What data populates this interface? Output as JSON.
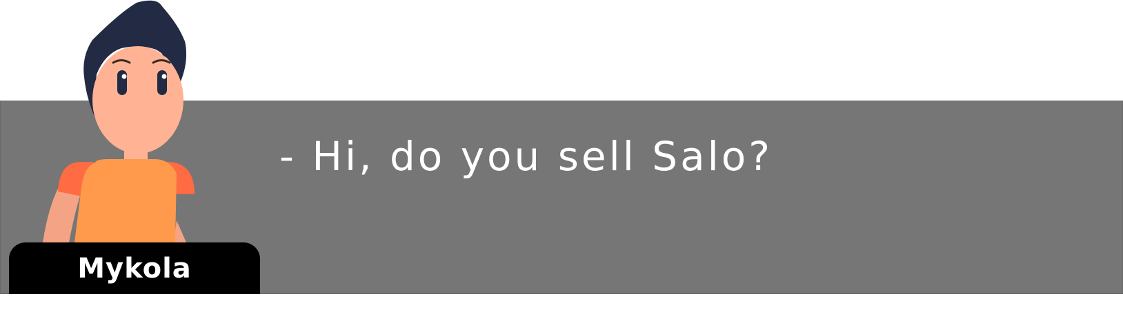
{
  "dialogue": {
    "speaker": "Mykola",
    "line": "- Hi, do you sell Salo?"
  },
  "colors": {
    "dialogue_background": "#767676",
    "nameplate_background": "#000000",
    "text": "#ffffff",
    "hair": "#222a44",
    "skin": "#ffb394",
    "shirt": "#ff9a4d",
    "sleeve": "#ff6b42"
  },
  "icons": {
    "character": "character-portrait-mykola"
  }
}
